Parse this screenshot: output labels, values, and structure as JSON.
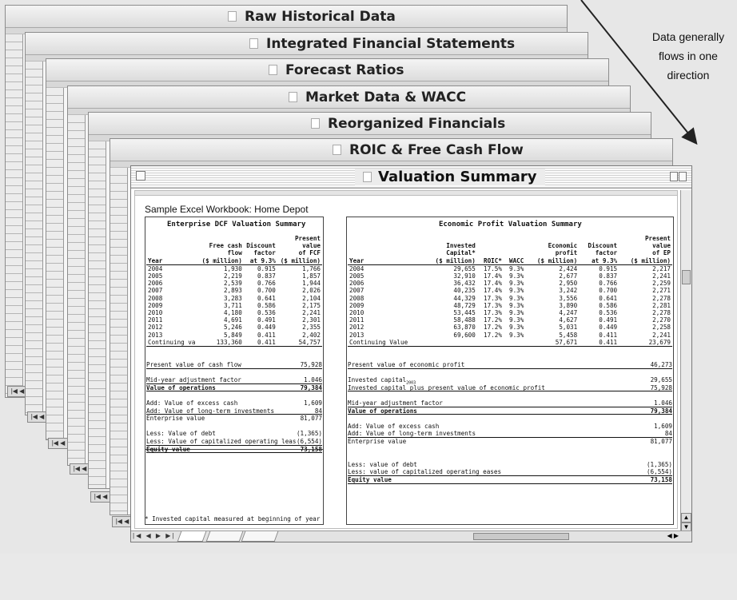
{
  "windows": [
    {
      "title": "Raw Historical Data"
    },
    {
      "title": "Integrated Financial Statements"
    },
    {
      "title": "Forecast Ratios"
    },
    {
      "title": "Market Data & WACC"
    },
    {
      "title": "Reorganized Financials"
    },
    {
      "title": "ROIC & Free Cash Flow"
    }
  ],
  "front_window": {
    "title": "Valuation Summary"
  },
  "workbook_title": "Sample Excel Workbook: Home Depot",
  "annotation": {
    "line1": "Data generally",
    "line2": "flows in one",
    "line3": "direction"
  },
  "dcf": {
    "title": "Enterprise DCF Valuation Summary",
    "headers": {
      "year": "Year",
      "fcf": [
        "Free cash",
        "flow",
        "($ million)"
      ],
      "factor": [
        "Discount",
        "factor",
        "at 9.3%"
      ],
      "pv": [
        "Present",
        "value",
        "of FCF",
        "($ million)"
      ]
    },
    "rows": [
      {
        "year": "2004",
        "fcf": "1,930",
        "factor": "0.915",
        "pv": "1,766"
      },
      {
        "year": "2005",
        "fcf": "2,219",
        "factor": "0.837",
        "pv": "1,857"
      },
      {
        "year": "2006",
        "fcf": "2,539",
        "factor": "0.766",
        "pv": "1,944"
      },
      {
        "year": "2007",
        "fcf": "2,893",
        "factor": "0.700",
        "pv": "2,026"
      },
      {
        "year": "2008",
        "fcf": "3,283",
        "factor": "0.641",
        "pv": "2,104"
      },
      {
        "year": "2009",
        "fcf": "3,711",
        "factor": "0.586",
        "pv": "2,175"
      },
      {
        "year": "2010",
        "fcf": "4,180",
        "factor": "0.536",
        "pv": "2,241"
      },
      {
        "year": "2011",
        "fcf": "4,691",
        "factor": "0.491",
        "pv": "2,301"
      },
      {
        "year": "2012",
        "fcf": "5,246",
        "factor": "0.449",
        "pv": "2,355"
      },
      {
        "year": "2013",
        "fcf": "5,849",
        "factor": "0.411",
        "pv": "2,402"
      },
      {
        "year": "Continuing va",
        "fcf": "133,360",
        "factor": "0.411",
        "pv": "54,757"
      }
    ],
    "pv_cash_flow": {
      "label": "Present value of cash flow",
      "value": "75,928"
    },
    "midyear": {
      "label": "Mid-year adjustment factor",
      "value": "1.046"
    },
    "ops": {
      "label": "Value of operations",
      "value": "79,384"
    },
    "excess_cash": {
      "label": "Add: Value of excess cash",
      "value": "1,609"
    },
    "lt_invest": {
      "label": "Add: Value of long-term investments",
      "value": "84"
    },
    "ev": {
      "label": "Enterprise value",
      "value": "81,077"
    },
    "debt": {
      "label": "Less: Value of debt",
      "value": "(1,365)"
    },
    "leases": {
      "label": "Less: Value of capitalized operating leas",
      "value": "(6,554)"
    },
    "equity": {
      "label": "Equity value",
      "value": "73,158"
    }
  },
  "ep": {
    "title": "Economic Profit Valuation Summary",
    "headers": {
      "year": "Year",
      "ic": [
        "Invested",
        "Capital*",
        "($ million)"
      ],
      "roic": "ROIC*",
      "wacc": "WACC",
      "profit": [
        "Economic",
        "profit",
        "($ million)"
      ],
      "factor": [
        "Discount",
        "factor",
        "at 9.3%"
      ],
      "pv": [
        "Present",
        "value",
        "of EP",
        "($ million)"
      ]
    },
    "rows": [
      {
        "year": "2004",
        "ic": "29,655",
        "roic": "17.5%",
        "wacc": "9.3%",
        "profit": "2,424",
        "factor": "0.915",
        "pv": "2,217"
      },
      {
        "year": "2005",
        "ic": "32,910",
        "roic": "17.4%",
        "wacc": "9.3%",
        "profit": "2,677",
        "factor": "0.837",
        "pv": "2,241"
      },
      {
        "year": "2006",
        "ic": "36,432",
        "roic": "17.4%",
        "wacc": "9.3%",
        "profit": "2,950",
        "factor": "0.766",
        "pv": "2,259"
      },
      {
        "year": "2007",
        "ic": "40,235",
        "roic": "17.4%",
        "wacc": "9.3%",
        "profit": "3,242",
        "factor": "0.700",
        "pv": "2,271"
      },
      {
        "year": "2008",
        "ic": "44,329",
        "roic": "17.3%",
        "wacc": "9.3%",
        "profit": "3,556",
        "factor": "0.641",
        "pv": "2,278"
      },
      {
        "year": "2009",
        "ic": "48,729",
        "roic": "17.3%",
        "wacc": "9.3%",
        "profit": "3,890",
        "factor": "0.586",
        "pv": "2,281"
      },
      {
        "year": "2010",
        "ic": "53,445",
        "roic": "17.3%",
        "wacc": "9.3%",
        "profit": "4,247",
        "factor": "0.536",
        "pv": "2,278"
      },
      {
        "year": "2011",
        "ic": "58,488",
        "roic": "17.2%",
        "wacc": "9.3%",
        "profit": "4,627",
        "factor": "0.491",
        "pv": "2,270"
      },
      {
        "year": "2012",
        "ic": "63,870",
        "roic": "17.2%",
        "wacc": "9.3%",
        "profit": "5,031",
        "factor": "0.449",
        "pv": "2,258"
      },
      {
        "year": "2013",
        "ic": "69,600",
        "roic": "17.2%",
        "wacc": "9.3%",
        "profit": "5,458",
        "factor": "0.411",
        "pv": "2,241"
      },
      {
        "year": "Continuing Value",
        "ic": "",
        "roic": "",
        "wacc": "",
        "profit": "57,671",
        "factor": "0.411",
        "pv": "23,679"
      }
    ],
    "pv_ep": {
      "label": "Present value of economic profit",
      "value": "46,273"
    },
    "ic_2003": {
      "label": "Invested capital",
      "sub": "2003",
      "value": "29,655"
    },
    "ic_plus": {
      "label": "Invested capital plus present value of economic profit",
      "value": "75,928"
    },
    "midyear": {
      "label": "Mid-year adjustment factor",
      "value": "1.046"
    },
    "ops": {
      "label": "Value of operations",
      "value": "79,384"
    },
    "excess_cash": {
      "label": "Add: Value of excess cash",
      "value": "1,609"
    },
    "lt_invest": {
      "label": "Add: Value of long-term investments",
      "value": "84"
    },
    "ev": {
      "label": "Enterprise value",
      "value": "81,077"
    },
    "debt": {
      "label": "Less: value of debt",
      "value": "(1,365)"
    },
    "leases": {
      "label": "Less: value of capitalized operating eases",
      "value": "(6,554)"
    },
    "equity": {
      "label": "Equity value",
      "value": "73,158"
    }
  },
  "footnote": "* Invested capital measured at beginning of year",
  "colors": {
    "arrow": "#222222",
    "window_border": "#8c8c8c",
    "background": "#e7e7e7"
  }
}
